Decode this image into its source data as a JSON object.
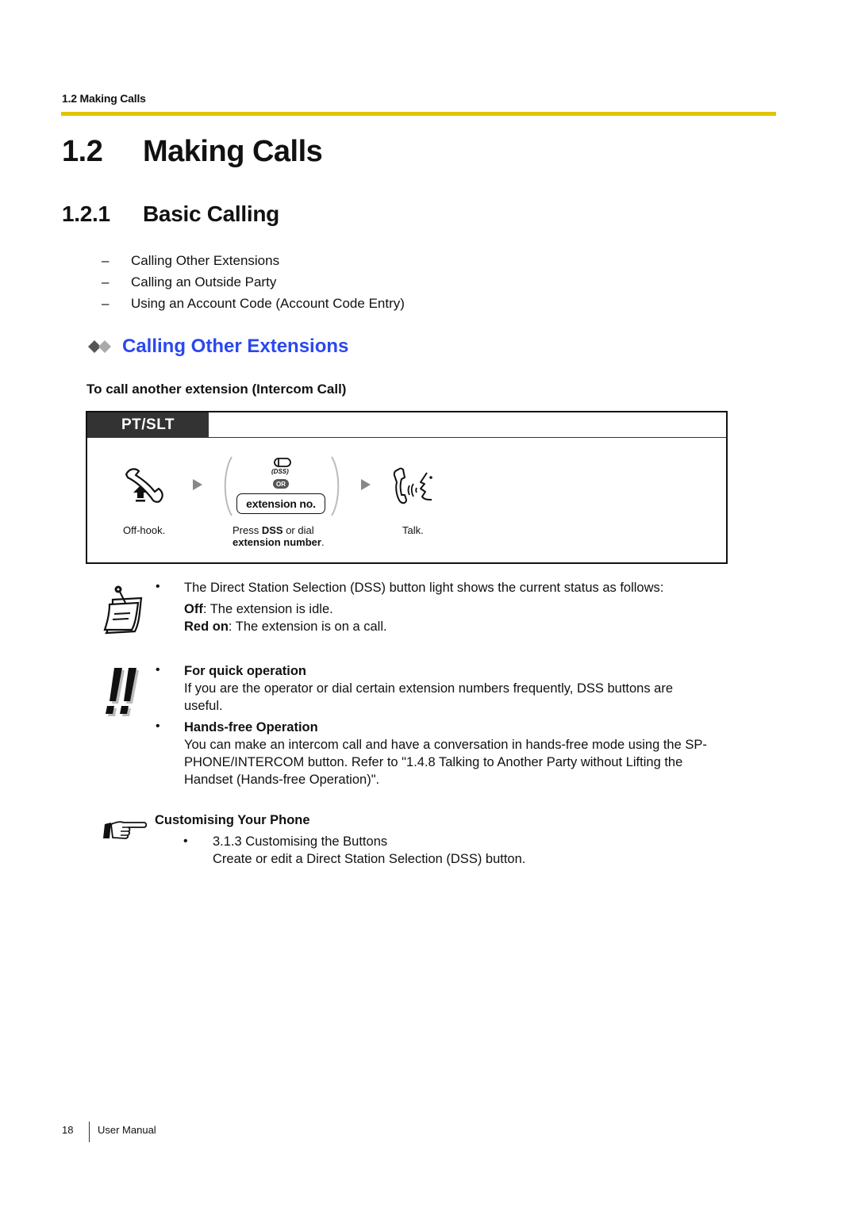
{
  "running_header": "1.2 Making Calls",
  "colors": {
    "header_rule": "#e2c400",
    "section_heading": "#2b48ee",
    "tab_background": "#333333"
  },
  "section": {
    "number": "1.2",
    "title": "Making Calls"
  },
  "subsection": {
    "number": "1.2.1",
    "title": "Basic Calling"
  },
  "toc": [
    {
      "dash": "–",
      "label": "Calling Other Extensions"
    },
    {
      "dash": "–",
      "label": "Calling an Outside Party"
    },
    {
      "dash": "–",
      "label": "Using an Account Code (Account Code Entry)"
    }
  ],
  "topic": {
    "icon": "double-diamond-icon",
    "title": "Calling Other Extensions"
  },
  "procedure": {
    "title": "To call another extension (Intercom Call)",
    "tab_label": "PT/SLT",
    "steps": [
      {
        "icon": "off-hook-handset-icon",
        "caption": "Off-hook."
      },
      {
        "icon": "dss-button-icon",
        "dss_label": "(DSS)",
        "or_label": "OR",
        "input_label": "extension no.",
        "caption_pre": "Press ",
        "caption_bold1": "DSS",
        "caption_mid": " or dial",
        "caption_bold2": "extension number",
        "caption_post": "."
      },
      {
        "icon": "talk-icon",
        "caption": "Talk."
      }
    ]
  },
  "note": {
    "icon": "note-memo-icon",
    "bullet": "•",
    "text": "The Direct Station Selection (DSS) button light shows the current status as follows:",
    "states": [
      {
        "label": "Off",
        "desc": ": The extension is idle."
      },
      {
        "label": "Red on",
        "desc": ": The extension is on a call."
      }
    ]
  },
  "tips": {
    "icon": "double-exclamation-icon",
    "items": [
      {
        "bullet": "•",
        "title": "For quick operation",
        "lines": [
          "If you are the operator or dial certain extension numbers frequently, DSS buttons are",
          "useful."
        ]
      },
      {
        "bullet": "•",
        "title": "Hands-free Operation",
        "lines": [
          "You can make an intercom call and have a conversation in hands-free mode using the SP-",
          "PHONE/INTERCOM button. Refer to \"1.4.8 Talking to Another Party without Lifting the",
          "Handset (Hands-free Operation)\"."
        ]
      }
    ]
  },
  "reference": {
    "icon": "pointing-hand-icon",
    "title": "Customising Your Phone",
    "bullet": "•",
    "link": "3.1.3 Customising the Buttons",
    "desc": "Create or edit a Direct Station Selection (DSS) button."
  },
  "footer": {
    "page_number": "18",
    "label": "User Manual"
  }
}
